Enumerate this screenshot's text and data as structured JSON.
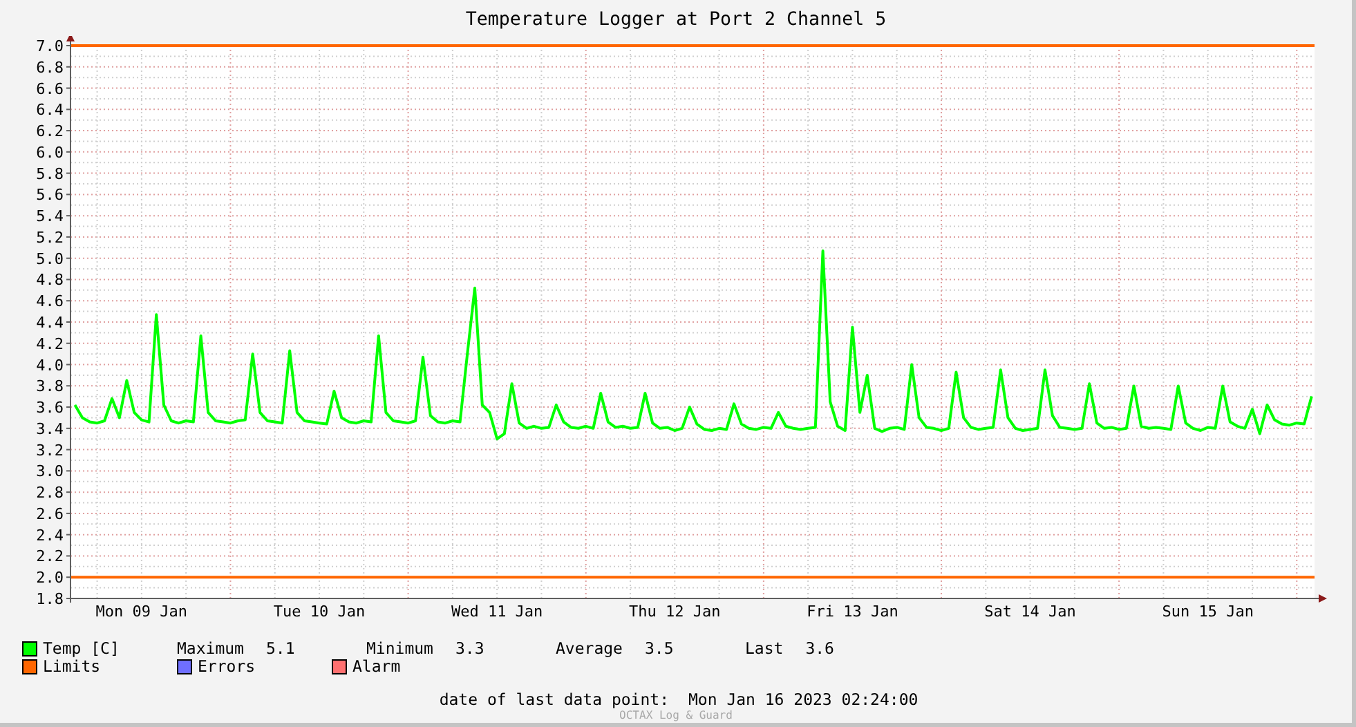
{
  "title": "Temperature Logger at Port 2 Channel 5",
  "chart_data": {
    "type": "line",
    "ylim": [
      1.8,
      7.0
    ],
    "categories": [
      null,
      null,
      null,
      null,
      null,
      null,
      null,
      null,
      null,
      "Mon 09 Jan",
      null,
      null,
      null,
      null,
      null,
      null,
      null,
      null,
      null,
      null,
      null,
      null,
      null,
      null,
      null,
      null,
      null,
      null,
      null,
      null,
      null,
      null,
      null,
      "Tue 10 Jan",
      null,
      null,
      null,
      null,
      null,
      null,
      null,
      null,
      null,
      null,
      null,
      null,
      null,
      null,
      null,
      null,
      null,
      null,
      null,
      null,
      null,
      null,
      null,
      "Wed 11 Jan",
      null,
      null,
      null,
      null,
      null,
      null,
      null,
      null,
      null,
      null,
      null,
      null,
      null,
      null,
      null,
      null,
      null,
      null,
      null,
      null,
      null,
      null,
      null,
      "Thu 12 Jan",
      null,
      null,
      null,
      null,
      null,
      null,
      null,
      null,
      null,
      null,
      null,
      null,
      null,
      null,
      null,
      null,
      null,
      null,
      null,
      null,
      null,
      null,
      null,
      "Fri 13 Jan",
      null,
      null,
      null,
      null,
      null,
      null,
      null,
      null,
      null,
      null,
      null,
      null,
      null,
      null,
      null,
      null,
      null,
      null,
      null,
      null,
      null,
      null,
      null,
      "Sat 14 Jan",
      null,
      null,
      null,
      null,
      null,
      null,
      null,
      null,
      null,
      null,
      null,
      null,
      null,
      null,
      null,
      null,
      null,
      null,
      null,
      null,
      null,
      null,
      null,
      "Sun 15 Jan",
      null,
      null,
      null,
      null,
      null,
      null,
      null,
      null,
      null,
      null,
      null,
      null,
      null,
      null
    ],
    "yticks": [
      {
        "value": 1.8,
        "label": "1.8"
      },
      {
        "value": 2.0,
        "label": "2.0"
      },
      {
        "value": 2.2,
        "label": "2.2"
      },
      {
        "value": 2.4,
        "label": "2.4"
      },
      {
        "value": 2.6,
        "label": "2.6"
      },
      {
        "value": 2.8,
        "label": "2.8"
      },
      {
        "value": 3.0,
        "label": "3.0"
      },
      {
        "value": 3.2,
        "label": "3.2"
      },
      {
        "value": 3.4,
        "label": "3.4"
      },
      {
        "value": 3.6,
        "label": "3.6"
      },
      {
        "value": 3.8,
        "label": "3.8"
      },
      {
        "value": 4.0,
        "label": "4.0"
      },
      {
        "value": 4.2,
        "label": "4.2"
      },
      {
        "value": 4.4,
        "label": "4.4"
      },
      {
        "value": 4.6,
        "label": "4.6"
      },
      {
        "value": 4.8,
        "label": "4.8"
      },
      {
        "value": 5.0,
        "label": "5.0"
      },
      {
        "value": 5.2,
        "label": "5.2"
      },
      {
        "value": 5.4,
        "label": "5.4"
      },
      {
        "value": 5.6,
        "label": "5.6"
      },
      {
        "value": 5.8,
        "label": "5.8"
      },
      {
        "value": 6.0,
        "label": "6.0"
      },
      {
        "value": 6.2,
        "label": "6.2"
      },
      {
        "value": 6.4,
        "label": "6.4"
      },
      {
        "value": 6.6,
        "label": "6.6"
      },
      {
        "value": 6.8,
        "label": "6.8"
      },
      {
        "value": 7.0,
        "label": "7.0"
      }
    ],
    "series": [
      {
        "name": "Temp [C]",
        "color": "#00ff00",
        "values": [
          3.62,
          3.5,
          3.46,
          3.45,
          3.47,
          3.68,
          3.5,
          3.85,
          3.55,
          3.48,
          3.46,
          4.47,
          3.62,
          3.47,
          3.45,
          3.47,
          3.46,
          4.27,
          3.55,
          3.47,
          3.46,
          3.45,
          3.47,
          3.48,
          4.1,
          3.55,
          3.47,
          3.46,
          3.45,
          4.13,
          3.55,
          3.47,
          3.46,
          3.45,
          3.44,
          3.75,
          3.5,
          3.46,
          3.45,
          3.47,
          3.46,
          4.27,
          3.55,
          3.47,
          3.46,
          3.45,
          3.47,
          4.07,
          3.52,
          3.46,
          3.45,
          3.47,
          3.46,
          4.1,
          4.72,
          3.62,
          3.55,
          3.3,
          3.35,
          3.82,
          3.45,
          3.4,
          3.42,
          3.4,
          3.41,
          3.62,
          3.46,
          3.41,
          3.4,
          3.42,
          3.4,
          3.73,
          3.46,
          3.41,
          3.42,
          3.4,
          3.41,
          3.73,
          3.45,
          3.4,
          3.41,
          3.38,
          3.4,
          3.6,
          3.44,
          3.39,
          3.38,
          3.4,
          3.39,
          3.63,
          3.44,
          3.4,
          3.39,
          3.41,
          3.4,
          3.55,
          3.42,
          3.4,
          3.39,
          3.4,
          3.41,
          5.07,
          3.65,
          3.42,
          3.38,
          4.35,
          3.55,
          3.9,
          3.4,
          3.37,
          3.4,
          3.41,
          3.39,
          4.0,
          3.5,
          3.41,
          3.4,
          3.38,
          3.4,
          3.93,
          3.5,
          3.41,
          3.39,
          3.4,
          3.41,
          3.95,
          3.5,
          3.4,
          3.38,
          3.39,
          3.4,
          3.95,
          3.52,
          3.41,
          3.4,
          3.39,
          3.4,
          3.82,
          3.45,
          3.4,
          3.41,
          3.39,
          3.4,
          3.8,
          3.42,
          3.4,
          3.41,
          3.4,
          3.39,
          3.8,
          3.45,
          3.4,
          3.38,
          3.41,
          3.4,
          3.8,
          3.46,
          3.42,
          3.4,
          3.58,
          3.35,
          3.62,
          3.48,
          3.44,
          3.43,
          3.45,
          3.44,
          3.7
        ]
      }
    ],
    "grid": true,
    "ref_lines": [
      {
        "axis": "y",
        "value": 7.0,
        "color": "#ff6600"
      },
      {
        "axis": "y",
        "value": 2.0,
        "color": "#ff6600"
      }
    ]
  },
  "series_stats": [
    {
      "label": "Maximum",
      "value": "5.1"
    },
    {
      "label": "Minimum",
      "value": "3.3"
    },
    {
      "label": "Average",
      "value": "3.5"
    },
    {
      "label": "Last",
      "value": "3.6"
    }
  ],
  "legend": [
    {
      "label": "Limits",
      "color": "#ff6600"
    },
    {
      "label": "Errors",
      "color": "#6f6fff"
    },
    {
      "label": "Alarm",
      "color": "#ff7070"
    }
  ],
  "last_data_point": {
    "label": "date of last data point:",
    "value": "Mon Jan 16 2023 02:24:00"
  },
  "credit": "OCTAX Log & Guard"
}
